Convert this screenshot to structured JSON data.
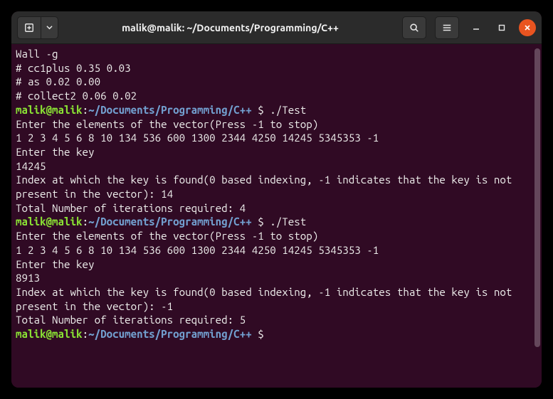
{
  "titlebar": {
    "title": "malik@malik: ~/Documents/Programming/C++"
  },
  "prompt": {
    "user": "malik@malik",
    "sep1": ":",
    "path": "~/Documents/Programming/C++",
    "dollar": " $ "
  },
  "terminal": {
    "preamble": [
      "Wall -g",
      "# cc1plus 0.35 0.03",
      "# as 0.02 0.00",
      "# collect2 0.06 0.02"
    ],
    "runs": [
      {
        "command": "./Test",
        "output": [
          "Enter the elements of the vector(Press -1 to stop)",
          "1 2 3 4 5 6 8 10 134 536 600 1300 2344 4250 14245 5345353 -1",
          "Enter the key",
          "14245",
          "Index at which the key is found(0 based indexing, -1 indicates that the key is not present in the vector): 14",
          "Total Number of iterations required: 4"
        ]
      },
      {
        "command": "./Test",
        "output": [
          "Enter the elements of the vector(Press -1 to stop)",
          "1 2 3 4 5 6 8 10 134 536 600 1300 2344 4250 14245 5345353 -1",
          "Enter the key",
          "8913",
          "Index at which the key is found(0 based indexing, -1 indicates that the key is not present in the vector): -1",
          "Total Number of iterations required: 5"
        ]
      }
    ],
    "trailing_command": ""
  }
}
